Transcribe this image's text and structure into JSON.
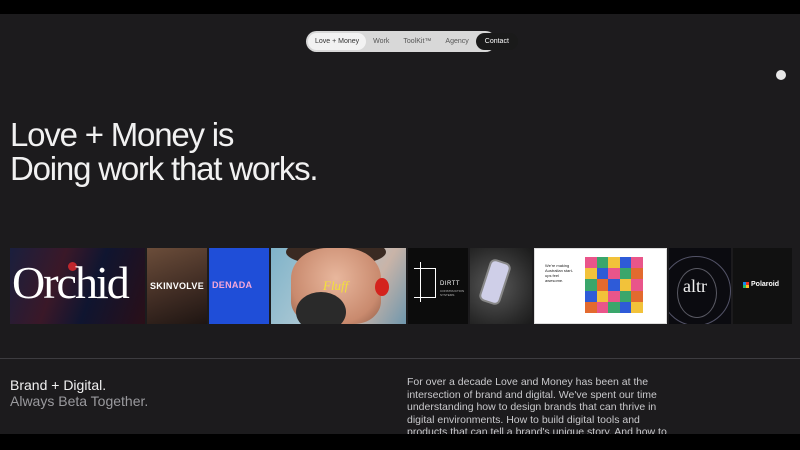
{
  "nav": {
    "items": [
      {
        "label": "Love + Money",
        "active": true
      },
      {
        "label": "Work",
        "active": false
      },
      {
        "label": "ToolKit™",
        "active": false
      },
      {
        "label": "Agency",
        "active": false
      }
    ],
    "contact_label": "Contact"
  },
  "hero": {
    "line1": "Love + Money is",
    "line2": "Doing work that works."
  },
  "projects": [
    {
      "name": "Orchid"
    },
    {
      "name": "SKINVOLVE"
    },
    {
      "name": "DENADA"
    },
    {
      "name": "Fluff"
    },
    {
      "name": "DIRTT",
      "subtitle": "CONSTRUCTION SYSTEMS"
    },
    {
      "name": "phone-mockup"
    },
    {
      "name": "website",
      "text": "We're making Australian start-ups feel awesome."
    },
    {
      "name": "altr"
    },
    {
      "name": "Polaroid"
    }
  ],
  "brand": {
    "line1": "Brand + Digital.",
    "line2": "Always Beta Together."
  },
  "about": {
    "text": "For over a decade Love and Money has been at the intersection of brand and digital. We've spent our time understanding how to design brands that can thrive in digital environments. How to build digital tools and products that can tell a brand's unique story. And how to"
  },
  "colors": {
    "background": "#1c1b1d",
    "nav_pill": "#d8d8d8",
    "contact_bg": "#1a1a1a",
    "denada_blue": "#1f4ed8",
    "denada_text": "#f7a8d8"
  }
}
